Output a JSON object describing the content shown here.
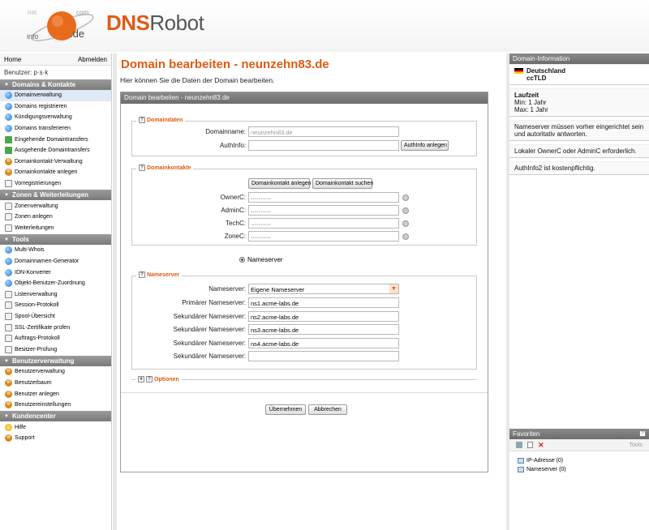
{
  "header": {
    "brand_a": "DNS",
    "brand_b": "Robot",
    "globe_labels": [
      "net",
      "com",
      "info",
      ".de"
    ]
  },
  "left": {
    "home": "Home",
    "logout": "Abmelden",
    "user_label": "Benutzer:",
    "user_value": "p·s·k",
    "sections": [
      {
        "title": "Domains & Kontakte",
        "items": [
          {
            "label": "Domainverwaltung",
            "icon": "globe",
            "selected": true
          },
          {
            "label": "Domains registrieren",
            "icon": "globe"
          },
          {
            "label": "Kündigungsverwaltung",
            "icon": "globe"
          },
          {
            "label": "Domains transferieren",
            "icon": "globe"
          },
          {
            "label": "Eingehende Domaintransfers",
            "icon": "green"
          },
          {
            "label": "Ausgehende Domaintransfers",
            "icon": "green"
          },
          {
            "label": "Domainkontakt-Verwaltung",
            "icon": "person"
          },
          {
            "label": "Domainkontakte anlegen",
            "icon": "person"
          },
          {
            "label": "Vorregistrierungen",
            "icon": "doc"
          }
        ]
      },
      {
        "title": "Zonen & Weiterleitungen",
        "items": [
          {
            "label": "Zonenverwaltung",
            "icon": "doc"
          },
          {
            "label": "Zonen anlegen",
            "icon": "doc"
          },
          {
            "label": "Weiterleitungen",
            "icon": "doc"
          }
        ]
      },
      {
        "title": "Tools",
        "items": [
          {
            "label": "Multi-Whois",
            "icon": "globe"
          },
          {
            "label": "Domainnamen-Generator",
            "icon": "globe"
          },
          {
            "label": "IDN-Konverter",
            "icon": "globe"
          },
          {
            "label": "Objekt-Benutzer-Zuordnung",
            "icon": "globe"
          },
          {
            "label": "Listenverwaltung",
            "icon": "doc"
          },
          {
            "label": "Session-Protokoll",
            "icon": "doc"
          },
          {
            "label": "Spool-Übersicht",
            "icon": "doc"
          },
          {
            "label": "SSL-Zertifikate prüfen",
            "icon": "doc"
          },
          {
            "label": "Auftrags-Protokoll",
            "icon": "doc"
          },
          {
            "label": "Besitzer-Prüfung",
            "icon": "doc"
          }
        ]
      },
      {
        "title": "Benutzerverwaltung",
        "items": [
          {
            "label": "Benutzerverwaltung",
            "icon": "person"
          },
          {
            "label": "Benutzerbaum",
            "icon": "person"
          },
          {
            "label": "Benutzer anlegen",
            "icon": "person"
          },
          {
            "label": "Benutzereinstellungen",
            "icon": "person"
          }
        ]
      },
      {
        "title": "Kundencenter",
        "items": [
          {
            "label": "Hilfe",
            "icon": "help"
          },
          {
            "label": "Support",
            "icon": "person"
          }
        ]
      }
    ]
  },
  "main": {
    "title": "Domain bearbeiten - neunzehn83.de",
    "subtitle": "Hier können Sie die Daten der Domain bearbeiten.",
    "panel_title": "Domain bearbeiten - neunzehn83.de",
    "domaindaten": {
      "legend": "Domaindaten",
      "domainname_label": "Domainname:",
      "domainname_value": "neunzehn83.de",
      "authinfo_label": "AuthInfo:",
      "authinfo_value": "",
      "authinfo_button": "AuthInfo anlegen"
    },
    "kontakte": {
      "legend": "Domainkontakte",
      "create_button": "Domainkontakt anlegen",
      "search_button": "Domainkontakt suchen",
      "rows": [
        {
          "label": "OwnerC:",
          "value": "··········"
        },
        {
          "label": "AdminC:",
          "value": "··········"
        },
        {
          "label": "TechC:",
          "value": "··········"
        },
        {
          "label": "ZoneC:",
          "value": "··········"
        }
      ]
    },
    "radio_label": "Nameserver",
    "nameserver": {
      "legend": "Nameserver",
      "select_label": "Nameserver:",
      "select_value": "Eigene Nameserver",
      "rows": [
        {
          "label": "Primärer Nameserver:",
          "value": "ns1.acme-labs.de"
        },
        {
          "label": "Sekundärer Nameserver:",
          "value": "ns2.acme-labs.de"
        },
        {
          "label": "Sekundärer Nameserver:",
          "value": "ns3.acme-labs.de"
        },
        {
          "label": "Sekundärer Nameserver:",
          "value": "ns4.acme-labs.de"
        },
        {
          "label": "Sekundärer Nameserver:",
          "value": ""
        }
      ]
    },
    "optionen_legend": "Optionen",
    "apply_button": "Übernehmen",
    "cancel_button": "Abbrechen"
  },
  "right": {
    "info_title": "Domain-Information",
    "country": "Deutschland",
    "tld_type": "ccTLD",
    "laufzeit_title": "Laufzeit",
    "min": "Min: 1 Jahr",
    "max": "Max: 1 Jahr",
    "notes": [
      "Nameserver müssen vorher eingerichtet sein und autoritativ antworten.",
      "Lokaler OwnerC oder AdminC erforderlich.",
      "AuthInfo2 ist kostenpflichtig."
    ],
    "fav_title": "Favoriten",
    "tools_label": "Tools",
    "fav_items": [
      "IP-Adresse (0)",
      "Nameserver (0)"
    ]
  }
}
